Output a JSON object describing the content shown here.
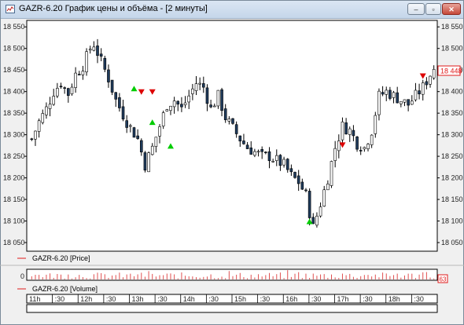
{
  "window": {
    "title": "GAZR-6.20 График цены и объёма - [2 минуты]",
    "buttons": {
      "minimize": "–",
      "maximize": "▫",
      "close": "✕"
    }
  },
  "colors": {
    "candle": "#000000",
    "body": "#1f3b5c",
    "marker_up": "#00cc00",
    "marker_down": "#dd0000",
    "price_label": "#e01b1b",
    "volume": "#e05050"
  },
  "chart_data": {
    "type": "candlestick",
    "instrument": "GAZR-6.20",
    "timeframe": "2 минуты",
    "y_ticks": [
      "18 550",
      "18 500",
      "18 450",
      "18 400",
      "18 350",
      "18 300",
      "18 250",
      "18 200",
      "18 150",
      "18 100",
      "18 050"
    ],
    "ylim": [
      18030,
      18565
    ],
    "last_price_label": "18 448",
    "close_path": [
      [
        0,
        18290
      ],
      [
        2,
        18330
      ],
      [
        4,
        18360
      ],
      [
        6,
        18400
      ],
      [
        8,
        18420
      ],
      [
        10,
        18395
      ],
      [
        12,
        18440
      ],
      [
        14,
        18460
      ],
      [
        16,
        18500
      ],
      [
        17,
        18510
      ],
      [
        19,
        18470
      ],
      [
        21,
        18430
      ],
      [
        23,
        18380
      ],
      [
        26,
        18330
      ],
      [
        29,
        18290
      ],
      [
        31,
        18230
      ],
      [
        33,
        18270
      ],
      [
        35,
        18320
      ],
      [
        37,
        18370
      ],
      [
        39,
        18380
      ],
      [
        41,
        18360
      ],
      [
        43,
        18390
      ],
      [
        45,
        18420
      ],
      [
        47,
        18410
      ],
      [
        49,
        18360
      ],
      [
        51,
        18390
      ],
      [
        53,
        18340
      ],
      [
        55,
        18315
      ],
      [
        57,
        18290
      ],
      [
        59,
        18270
      ],
      [
        61,
        18260
      ],
      [
        63,
        18250
      ],
      [
        65,
        18250
      ],
      [
        67,
        18240
      ],
      [
        69,
        18230
      ],
      [
        71,
        18205
      ],
      [
        73,
        18190
      ],
      [
        75,
        18160
      ],
      [
        76,
        18120
      ],
      [
        77,
        18085
      ],
      [
        79,
        18140
      ],
      [
        81,
        18200
      ],
      [
        83,
        18270
      ],
      [
        85,
        18320
      ],
      [
        87,
        18310
      ],
      [
        89,
        18280
      ],
      [
        91,
        18270
      ],
      [
        93,
        18310
      ],
      [
        95,
        18390
      ],
      [
        97,
        18400
      ],
      [
        99,
        18390
      ],
      [
        101,
        18380
      ],
      [
        103,
        18370
      ],
      [
        105,
        18390
      ],
      [
        107,
        18410
      ],
      [
        109,
        18440
      ],
      [
        110,
        18455
      ]
    ],
    "markers": [
      {
        "i": 28,
        "price": 18408,
        "kind": "up"
      },
      {
        "i": 30,
        "price": 18398,
        "kind": "down"
      },
      {
        "i": 33,
        "price": 18398,
        "kind": "down"
      },
      {
        "i": 33,
        "price": 18330,
        "kind": "up"
      },
      {
        "i": 38,
        "price": 18275,
        "kind": "up"
      },
      {
        "i": 76,
        "price": 18100,
        "kind": "up"
      },
      {
        "i": 85,
        "price": 18275,
        "kind": "down"
      },
      {
        "i": 107,
        "price": 18435,
        "kind": "down"
      }
    ],
    "series": [
      {
        "name": "GAZR-6.20 [Price]"
      },
      {
        "name": "GAZR-6.20 [Volume]"
      }
    ],
    "volume": {
      "y_tick": "0",
      "last_label": "63"
    },
    "time_axis": [
      "11h",
      ":30",
      "12h",
      ":30",
      "13h",
      ":30",
      "14h",
      ":30",
      "15h",
      ":30",
      "16h",
      ":30",
      "17h",
      ":30",
      "18h",
      ":30"
    ]
  }
}
